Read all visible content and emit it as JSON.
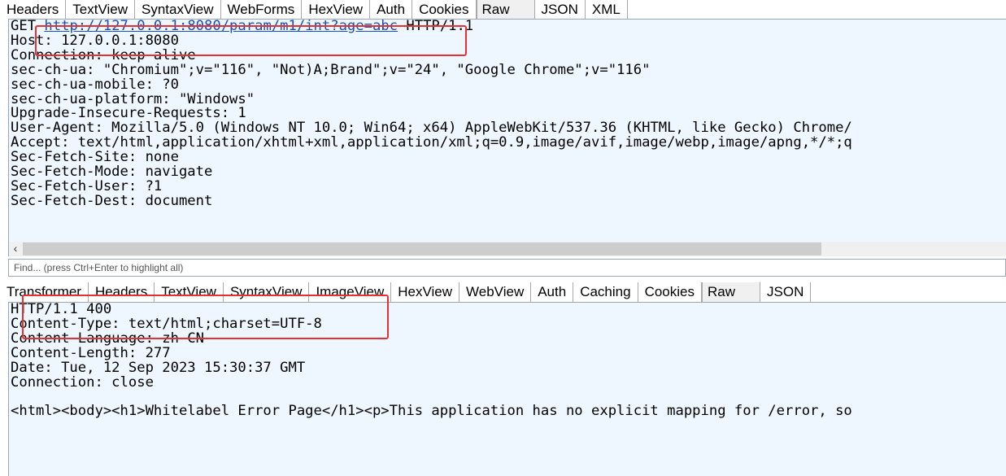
{
  "request": {
    "tabs": [
      "Headers",
      "TextView",
      "SyntaxView",
      "WebForms",
      "HexView",
      "Auth",
      "Cookies",
      "Raw",
      "JSON",
      "XML"
    ],
    "active_tab": "Raw",
    "method": "GET",
    "url": "http://127.0.0.1:8080/param/m1/int?age=abc",
    "protocol": "HTTP/1.1",
    "lines": [
      "Host: 127.0.0.1:8080",
      "Connection: keep-alive",
      "sec-ch-ua: \"Chromium\";v=\"116\", \"Not)A;Brand\";v=\"24\", \"Google Chrome\";v=\"116\"",
      "sec-ch-ua-mobile: ?0",
      "sec-ch-ua-platform: \"Windows\"",
      "Upgrade-Insecure-Requests: 1",
      "User-Agent: Mozilla/5.0 (Windows NT 10.0; Win64; x64) AppleWebKit/537.36 (KHTML, like Gecko) Chrome/",
      "Accept: text/html,application/xhtml+xml,application/xml;q=0.9,image/avif,image/webp,image/apng,*/*;q",
      "Sec-Fetch-Site: none",
      "Sec-Fetch-Mode: navigate",
      "Sec-Fetch-User: ?1",
      "Sec-Fetch-Dest: document"
    ]
  },
  "find": {
    "placeholder": "Find... (press Ctrl+Enter to highlight all)"
  },
  "response": {
    "tabs": [
      "Transformer",
      "Headers",
      "TextView",
      "SyntaxView",
      "ImageView",
      "HexView",
      "WebView",
      "Auth",
      "Caching",
      "Cookies",
      "Raw",
      "JSON"
    ],
    "active_tab": "Raw",
    "lines": [
      "HTTP/1.1 400",
      "Content-Type: text/html;charset=UTF-8",
      "Content-Language: zh-CN",
      "Content-Length: 277",
      "Date: Tue, 12 Sep 2023 15:30:37 GMT",
      "Connection: close",
      "",
      "<html><body><h1>Whitelabel Error Page</h1><p>This application has no explicit mapping for /error, so"
    ]
  },
  "colors": {
    "pane_background": "#eef6ff",
    "highlight_box": "#e8312f",
    "url_link": "#1a4fb5"
  }
}
